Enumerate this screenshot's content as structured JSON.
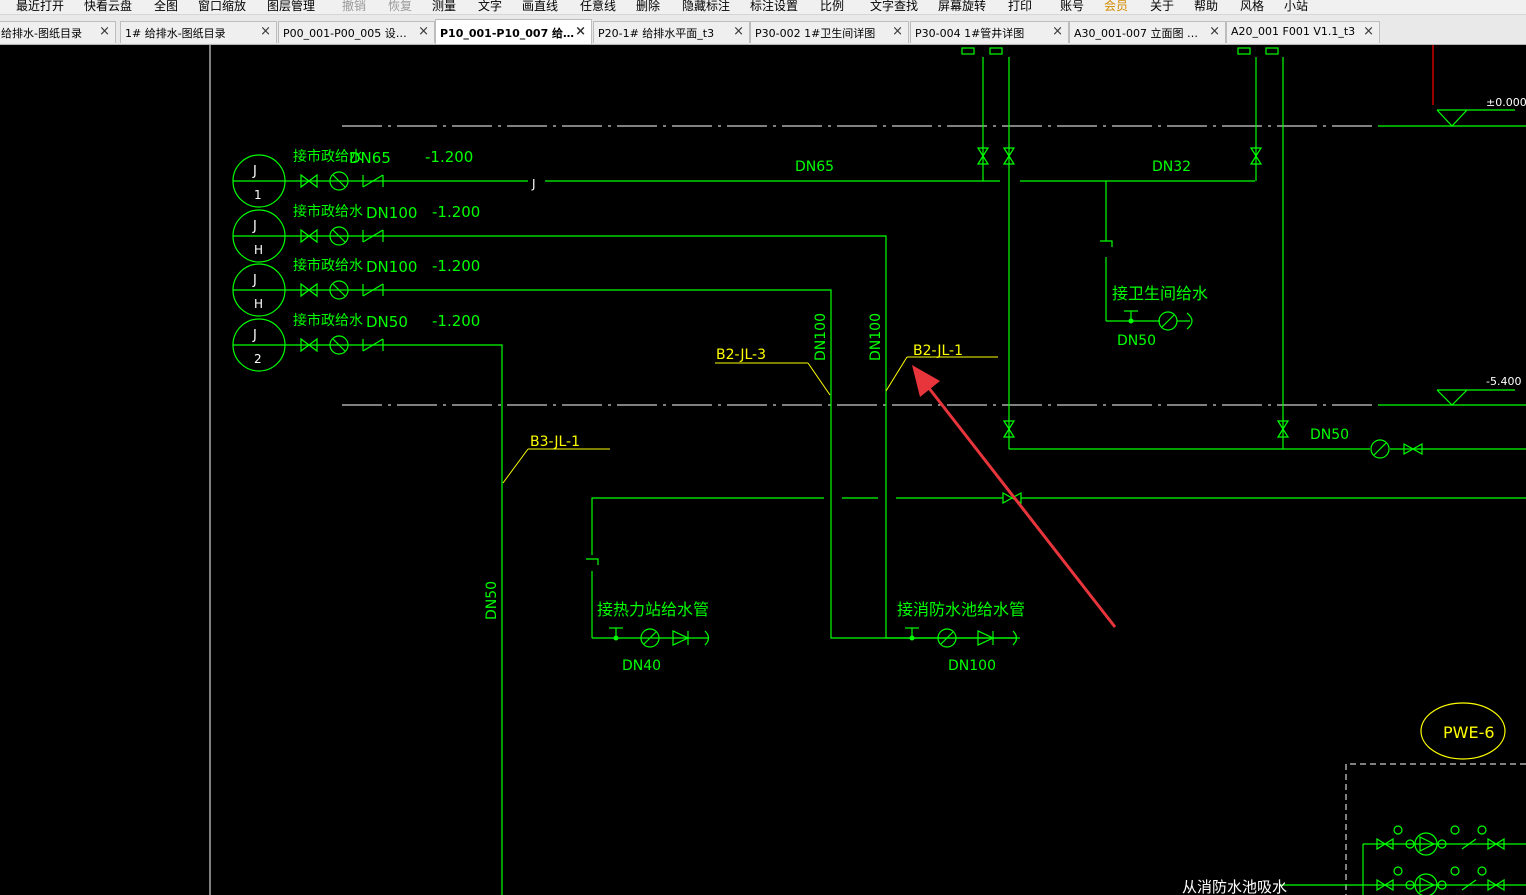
{
  "menu": [
    "最近打开",
    "快看云盘",
    "全图",
    "窗口缩放",
    "图层管理",
    "撤销",
    "恢复",
    "测量",
    "文字",
    "画直线",
    "任意线",
    "删除",
    "隐藏标注",
    "标注设置",
    "比例",
    "文字查找",
    "屏幕旋转",
    "打印",
    "账号",
    "会员",
    "关于",
    "帮助",
    "风格",
    "小站"
  ],
  "tabs": [
    {
      "label": "给排水-图纸目录",
      "close": "×"
    },
    {
      "label": "1# 给排水-图纸目录",
      "close": "×"
    },
    {
      "label": "P00_001-P00_005 设…",
      "close": "×"
    },
    {
      "label": "P10_001-P10_007 给…",
      "close": "×",
      "active": true
    },
    {
      "label": "P20-1# 给排水平面_t3",
      "close": "×"
    },
    {
      "label": "P30-002 1#卫生间详图",
      "close": "×"
    },
    {
      "label": "P30-004 1#管井详图",
      "close": "×"
    },
    {
      "label": "A30_001-007 立面图 …",
      "close": "×"
    },
    {
      "label": "A20_001 F001 V1.1_t3",
      "close": "×"
    }
  ],
  "drawing": {
    "colors": {
      "pipe": "#00ff00",
      "label_yellow": "#ffff00",
      "arrow": "#e8353b",
      "border": "#ffffff",
      "elevation_line": "#ffffff",
      "riser_red": "#ff0000"
    },
    "left_circles": [
      {
        "top": "J",
        "bottom": "1"
      },
      {
        "top": "J",
        "bottom": "H"
      },
      {
        "top": "J",
        "bottom": "H"
      },
      {
        "top": "J",
        "bottom": "2"
      }
    ],
    "inlet_rows": [
      {
        "label": "接市政给水",
        "dn": "DN65",
        "elev": "-1.200"
      },
      {
        "label": "接市政给水",
        "dn": "DN100",
        "elev": "-1.200"
      },
      {
        "label": "接市政给水",
        "dn": "DN100",
        "elev": "-1.200"
      },
      {
        "label": "接市政给水",
        "dn": "DN50",
        "elev": "-1.200"
      }
    ],
    "pipe_sizes": {
      "main_dn65": "DN65",
      "dn32": "DN32",
      "riser_dn100_a": "DN100",
      "riser_dn100_b": "DN100",
      "riser_dn50": "DN50",
      "dn50_lower": "DN50",
      "dn50_toilet": "DN50",
      "dn40": "DN40",
      "dn100_fire": "DN100"
    },
    "pipe_tags": {
      "b2_jl_3": "B2-JL-3",
      "b2_jl_1": "B2-JL-1",
      "b3_jl_1": "B3-JL-1"
    },
    "branch_labels": {
      "toilet": "接卫生间给水",
      "heat_station": "接热力站给水管",
      "fire_pool": "接消防水池给水管",
      "pump_suction": "从消防水池吸水"
    },
    "line_marker_j": "J",
    "elevations": {
      "top": "±0.000",
      "bottom": "-5.400"
    },
    "equipment_tag": "PWE-6"
  }
}
